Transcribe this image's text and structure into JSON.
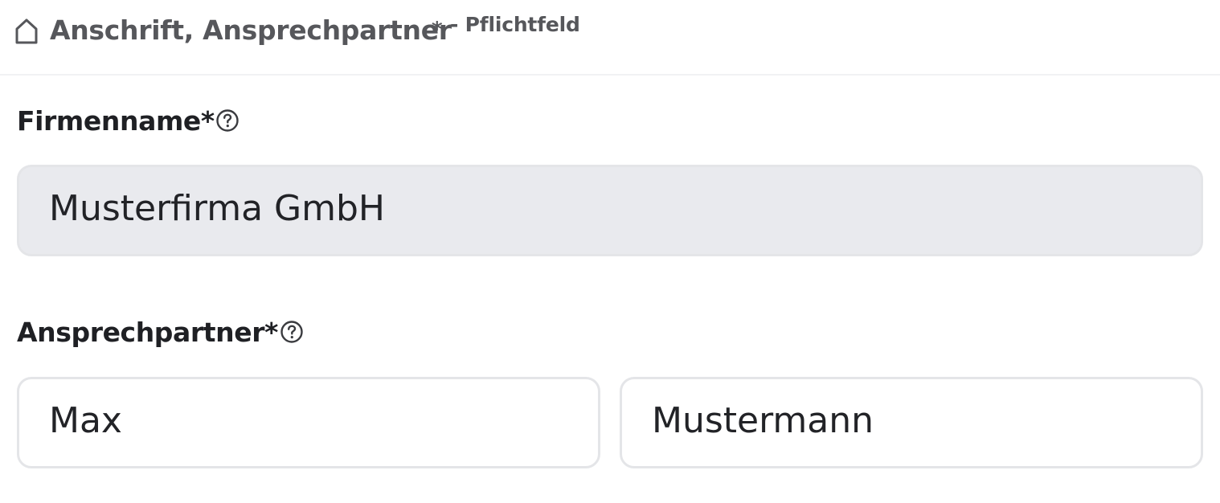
{
  "header": {
    "icon": "home-icon",
    "title": "Anschrift, Ansprechpartner",
    "required_marker": "*",
    "required_note": "- Pflichtfeld"
  },
  "fields": {
    "company": {
      "label": "Firmenname*",
      "help_icon": "question-circle-icon",
      "value": "Musterfirma GmbH",
      "readonly": true
    },
    "contact": {
      "label": "Ansprechpartner*",
      "help_icon": "question-circle-icon",
      "first_name": "Max",
      "last_name": "Mustermann"
    }
  },
  "colors": {
    "header_text": "#56575b",
    "label_text": "#1f2024",
    "input_border": "#e4e5e8",
    "readonly_background": "#e9eaee"
  }
}
